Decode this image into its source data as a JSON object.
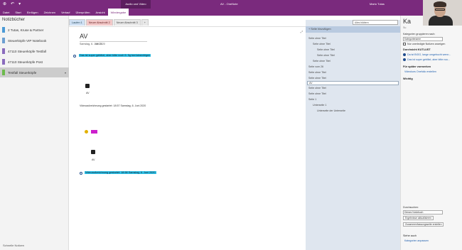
{
  "titlebar": {
    "quick_access": [
      "⊕",
      "↶",
      "▾"
    ],
    "context_tab": "Audio und Video",
    "doc_title": "AV  -  OneNote",
    "user_name": "Mario Tutas"
  },
  "ribbon": {
    "tabs": [
      "Datei",
      "Start",
      "Einfügen",
      "Zeichnen",
      "Verlauf",
      "Überprüfen",
      "Ansicht",
      "Wiedergabe"
    ],
    "active_index": 7
  },
  "notebooks": {
    "header": "Notizbücher",
    "items": [
      {
        "label": "2 Tutas, Kruse & Partner",
        "color": "#4b9ad6"
      },
      {
        "label": "Steuerköpfe VIP Notebook",
        "color": "#6d9fd1"
      },
      {
        "label": "47110 Steuerköpfe Testfall",
        "color": "#8a6bbd"
      },
      {
        "label": "47110 Steuerköpfe Post",
        "color": "#8a6bbd"
      },
      {
        "label": "Testfall Steuerköpfe",
        "color": "#6cba4c"
      }
    ],
    "selected_index": 4,
    "quick_notes": "Schnelle Notizen"
  },
  "sections": {
    "tabs": [
      {
        "label": "Laufen 1",
        "style": "t-blue"
      },
      {
        "label": "Neuer Abschnitt 2",
        "style": "t-pink"
      },
      {
        "label": "Neuer Abschnitt 3",
        "style": "t-grey"
      }
    ],
    "add_label": "+"
  },
  "page": {
    "title": "AV",
    "date": "Samstag, 6. Juni 2020",
    "time": "08:13",
    "line1": "Das ist super geblitzt, aber bitte noch 5. 5g berücksichtigen",
    "av_label_1": "AV",
    "recording_note": "Videoaufzeichnung gestartet: 18:57 Samstag, 6. Juni 2020",
    "av_label_2": "AV",
    "line_bottom": "Videoaufzeichnung gestartet: 18:58 Samstag, 6. Juni 2020"
  },
  "pagelist": {
    "search_placeholder": "Alles blättern",
    "add_page": "+ Seite hinzufügen",
    "pages": [
      {
        "label": "Seite ohne Titel",
        "indent": 0
      },
      {
        "label": "Seite ohne Titel",
        "indent": 1
      },
      {
        "label": "Seite ohne Titel",
        "indent": 2
      },
      {
        "label": "Seite ohne Titel",
        "indent": 2
      },
      {
        "label": "Seite ohne Titel",
        "indent": 1
      },
      {
        "label": "Seite vom 26",
        "indent": 0
      },
      {
        "label": "Seite ohne Titel",
        "indent": 0
      },
      {
        "label": "Seite ohne Titel",
        "indent": 0
      },
      {
        "label": "AV",
        "indent": 0,
        "selected": true
      },
      {
        "label": "Seite ohne Titel",
        "indent": 0
      },
      {
        "label": "Seite ohne Titel",
        "indent": 0
      },
      {
        "label": "Seite 1",
        "indent": 0
      },
      {
        "label": "Unterseite 1",
        "indent": 1
      },
      {
        "label": "Unterseite der Unterseite",
        "indent": 2
      }
    ]
  },
  "rightpane": {
    "title": "Ka",
    "subtitle": "Su",
    "group_label": "Kategorien gruppieren nach:",
    "group_value": "Kategoriename",
    "only_unchecked": "Nur unerledigte Notizen anzeigen",
    "section_label": "Durchsicht KUTLUST",
    "radio1": "Da ist BIGG, lange umgebucht wenn...",
    "radio2": "Das ist super geblitzt, aber bitte noc...",
    "for_later": "Für später vormerken",
    "for_later_link": "Videokurs Onefolio erstellen",
    "important": "Wichtig",
    "search_label": "Durchsuchen:",
    "search_value": "Dieses Notizbuch",
    "btn_refresh": "Ergebnisse aktualisieren",
    "btn_summary": "Zusammenfassungsseite erstellen",
    "see_also": "Siehe auch",
    "see_also_link": "Kategorien anpassen"
  }
}
